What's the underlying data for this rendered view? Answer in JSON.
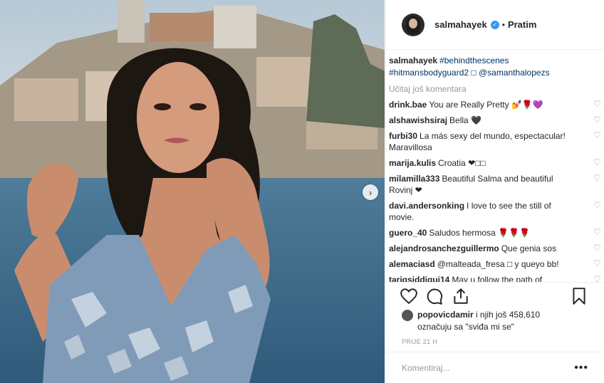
{
  "post": {
    "author": "salmahayek",
    "follow_separator": "•",
    "follow_label": "Pratim",
    "caption_user": "salmahayek",
    "caption_text": "#behindthescenes #hitmansbodyguard2 □ @samanthalopezs",
    "load_more": "Učitaj još komentara",
    "comments": [
      {
        "user": "drink.bae",
        "text": "You are Really Pretty 💅🌹💜"
      },
      {
        "user": "alshawishsiraj",
        "text": "Bella 🖤"
      },
      {
        "user": "furbi30",
        "text": "La más sexy del mundo, espectacular! Maravillosa"
      },
      {
        "user": "marija.kulis",
        "text": "Croatia ❤□□"
      },
      {
        "user": "milamilla333",
        "text": "Beautiful Salma and beautiful Rovinj ❤"
      },
      {
        "user": "davi.andersonking",
        "text": "I love to see the still of movie."
      },
      {
        "user": "guero_40",
        "text": "Saludos hermosa 🌹🌹🌹"
      },
      {
        "user": "alejandrosanchezguillermo",
        "text": "Que genia sos"
      },
      {
        "user": "alemaciasd",
        "text": "@malteada_fresa □ y queyo bb!"
      },
      {
        "user": "tariqsiddiqui14",
        "text": "May u follow the path of"
      }
    ],
    "likes_user": "popovicdamir",
    "likes_text": "i njih još 458,610",
    "likes_text2": "označuju sa \"sviđa mi se\"",
    "timestamp": "PRIJE 21 H",
    "comment_placeholder": "Komentiraj...",
    "more_label": "•••",
    "next_arrow": "›"
  },
  "icons": [
    "heart-icon",
    "comment-icon",
    "share-icon",
    "bookmark-icon",
    "verified-badge-icon",
    "chevron-right-icon"
  ],
  "colors": {
    "link": "#003569",
    "muted": "#999999",
    "verified": "#3897f0",
    "border": "#efefef"
  }
}
